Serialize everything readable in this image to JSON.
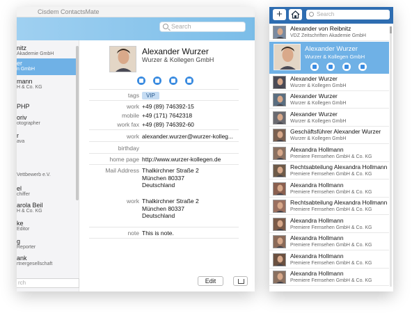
{
  "main_window": {
    "title": "Cisdem ContactsMate",
    "search_placeholder": "Search",
    "bottom_search_placeholder": "rch",
    "sidebar": [
      {
        "name": "nitz",
        "company": "Akademie GmbH"
      },
      {
        "name": "er",
        "company": "n GmbH",
        "selected": true
      },
      {
        "name": "mann",
        "company": "H & Co. KG"
      },
      {
        "name": "PHP",
        "company": ""
      },
      {
        "name": "oriv",
        "company": "otographer"
      },
      {
        "name": "r",
        "company": "ava"
      },
      {
        "name": "",
        "company": "Vettbewerb e.V."
      },
      {
        "name": "el",
        "company": "chiffer"
      },
      {
        "name": "arola Beil",
        "company": "H & Co. KG"
      },
      {
        "name": "ke",
        "company": "Editor"
      },
      {
        "name": "g",
        "company": "Reporter"
      },
      {
        "name": "ank",
        "company": "rtnergesellschaft"
      }
    ],
    "contact": {
      "name": "Alexander Wurzer",
      "company": "Wurzer & Kollegen GmbH",
      "fields": [
        {
          "label": "tags",
          "value": "VIP",
          "type": "tag"
        },
        {
          "label": "work",
          "value": "+49 (89) 746392-15"
        },
        {
          "label": "mobile",
          "value": "+49 (171) 7642318"
        },
        {
          "label": "work fax",
          "value": "+49 (89) 746392-60"
        },
        {
          "label": "work",
          "value": "alexander.wurzer@wurzer-kolleg..."
        },
        {
          "label": "birthday",
          "value": ""
        },
        {
          "label": "home page",
          "value": "http://www.wurzer-kollegen.de"
        },
        {
          "label": "Mail Address",
          "value": "Thalkirchner Straße 2\nMünchen 80337\nDeutschland"
        },
        {
          "label": "work",
          "value": "Thalkirchner Straße 2\nMünchen 80337\nDeutschland"
        },
        {
          "label": "note",
          "value": "This is note."
        }
      ]
    },
    "edit_label": "Edit"
  },
  "side_window": {
    "add_icon": "+",
    "search_placeholder": "Search",
    "selected": {
      "name": "Alexander Wurzer",
      "company": "Wurzer & Kollegen GmbH"
    },
    "contacts": [
      {
        "name": "Alexander von Reibnitz",
        "company": "VDZ Zeitschriften Akademie GmbH"
      },
      {
        "name": "Alexander Wurzer",
        "company": "Wurzer & Kollegen GmbH"
      },
      {
        "name": "Alexander Wurzer",
        "company": "Wurzer & Kollegen GmbH"
      },
      {
        "name": "Alexander Wurzer",
        "company": "Wurzer & Kollegen GmbH"
      },
      {
        "name": "Alexander Wurzer",
        "company": "Wurzer & Kollegen GmbH"
      },
      {
        "name": "Geschäftsführer Alexander Wurzer",
        "company": "Wurzer & Kollegen GmbH"
      },
      {
        "name": "Alexandra Hollmann",
        "company": "Premiere Fernsehen GmbH & Co. KG"
      },
      {
        "name": "Rechtsabteilung Alexandra Hollmann",
        "company": "Premiere Fernsehen GmbH & Co. KG"
      },
      {
        "name": "Alexandra Hollmann",
        "company": "Premiere Fernsehen GmbH & Co. KG"
      },
      {
        "name": "Rechtsabteilung Alexandra Hollmann",
        "company": "Premiere Fernsehen GmbH & Co. KG"
      },
      {
        "name": "Alexandra Hollmann",
        "company": "Premiere Fernsehen GmbH & Co. KG"
      },
      {
        "name": "Alexandra Hollmann",
        "company": "Premiere Fernsehen GmbH & Co. KG"
      },
      {
        "name": "Alexandra Hollmann",
        "company": "Premiere Fernsehen GmbH & Co. KG"
      },
      {
        "name": "Alexandra Hollmann",
        "company": "Premiere Fernsehen GmbH & Co. KG"
      }
    ]
  }
}
